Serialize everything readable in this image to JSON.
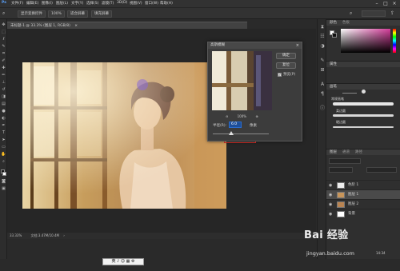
{
  "menubar": {
    "items": [
      "文件(F)",
      "编辑(E)",
      "图像(I)",
      "图层(L)",
      "文字(Y)",
      "选择(S)",
      "滤镜(T)",
      "3D(D)",
      "视图(V)",
      "窗口(W)",
      "帮助(H)"
    ]
  },
  "optionsbar": {
    "show_transform_controls": "显示变换控件",
    "zoom_value": "100%",
    "fit_screen": "适合屏幕",
    "fill_screen": "填充屏幕"
  },
  "document": {
    "tab_title": "未标题-1 @ 33.3% (图层 1, RGB/8)",
    "status_zoom": "33.33%",
    "status_doc": "文档:3.47M/10.4M"
  },
  "dialog": {
    "title": "高斯模糊",
    "ok_label": "确定",
    "reset_label": "复位",
    "preview_label": "预览(P)",
    "preview_checked": true,
    "zoom_value": "100%",
    "radius_label": "半径(R):",
    "radius_value": "6.0",
    "unit": "像素"
  },
  "panels": {
    "color_tab": "颜色",
    "swatches_tab": "色板",
    "properties_tab": "属性",
    "brushes_tab": "画笔",
    "brush_presets": [
      "常规画笔",
      "柔边圆",
      "硬边圆"
    ],
    "layers_tab": "图层",
    "channels_tab": "通道",
    "paths_tab": "路径",
    "layers": [
      {
        "name": "色阶 1",
        "visible": true,
        "selected": false
      },
      {
        "name": "图层 1",
        "visible": true,
        "selected": true
      },
      {
        "name": "图层 2",
        "visible": true,
        "selected": false
      },
      {
        "name": "背景",
        "visible": true,
        "selected": false
      }
    ],
    "clock": "14:34"
  },
  "ime": {
    "text": "英 ♪ ☺ ▦ ⚙"
  },
  "watermark": {
    "brand": "Bai 经验",
    "url": "jingyan.baidu.com"
  },
  "colors": {
    "accent": "#2a6bcc",
    "highlight_box": "#e0312b",
    "ui_bg": "#2a2a2a"
  }
}
